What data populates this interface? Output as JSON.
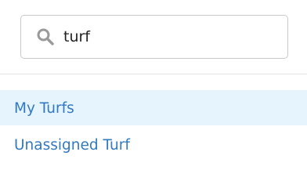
{
  "search": {
    "value": "turf",
    "icon": "search-icon"
  },
  "results": {
    "items": [
      {
        "label": "My Turfs",
        "highlighted": true
      },
      {
        "label": "Unassigned Turf",
        "highlighted": false
      }
    ]
  },
  "colors": {
    "link": "#3179c0",
    "highlight_bg": "#e6f4fd",
    "border": "#c9c9c9",
    "icon": "#9a9a9a"
  }
}
